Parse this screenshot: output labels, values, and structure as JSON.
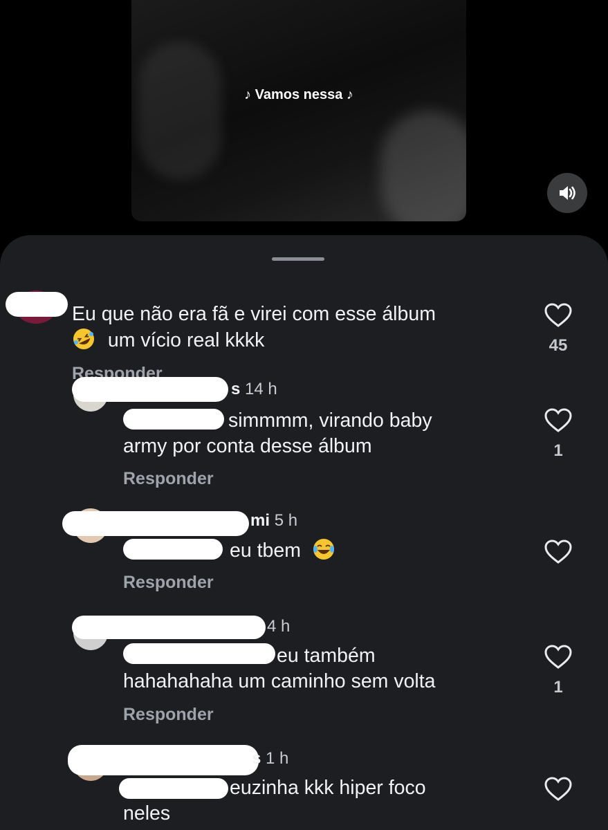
{
  "video": {
    "subtitle": "♪ Vamos nessa ♪",
    "sound_icon": "speaker-volume-icon"
  },
  "comments": [
    {
      "text_line1": "Eu que não era fã e virei com esse álbum",
      "text_line2": "um vício real kkkk",
      "emoji": "rolling-on-floor-laughing-emoji",
      "reply_label": "Responder",
      "likes": "45"
    }
  ],
  "replies": [
    {
      "username_tail": "s",
      "time": "14 h",
      "text_line1": "simmmm, virando baby",
      "text_line2": "army por conta desse álbum",
      "reply_label": "Responder",
      "likes": "1"
    },
    {
      "username_tail": "mi",
      "time": "5 h",
      "text_line1": "eu tbem",
      "emoji": "face-with-tears-of-joy-emoji",
      "reply_label": "Responder",
      "likes": ""
    },
    {
      "username_tail": "",
      "time": "4 h",
      "text_line1": "eu também",
      "text_line2": "hahahahaha um caminho sem volta",
      "reply_label": "Responder",
      "likes": "1"
    },
    {
      "username_tail": "s",
      "time": "1 h",
      "text_line1": "euzinha kkk hiper foco",
      "text_line2": "neles",
      "likes": ""
    }
  ],
  "colors": {
    "sheet_background": "#1c1e22",
    "mention_blue": "#5e8cff",
    "secondary_text": "#9fa3aa"
  }
}
